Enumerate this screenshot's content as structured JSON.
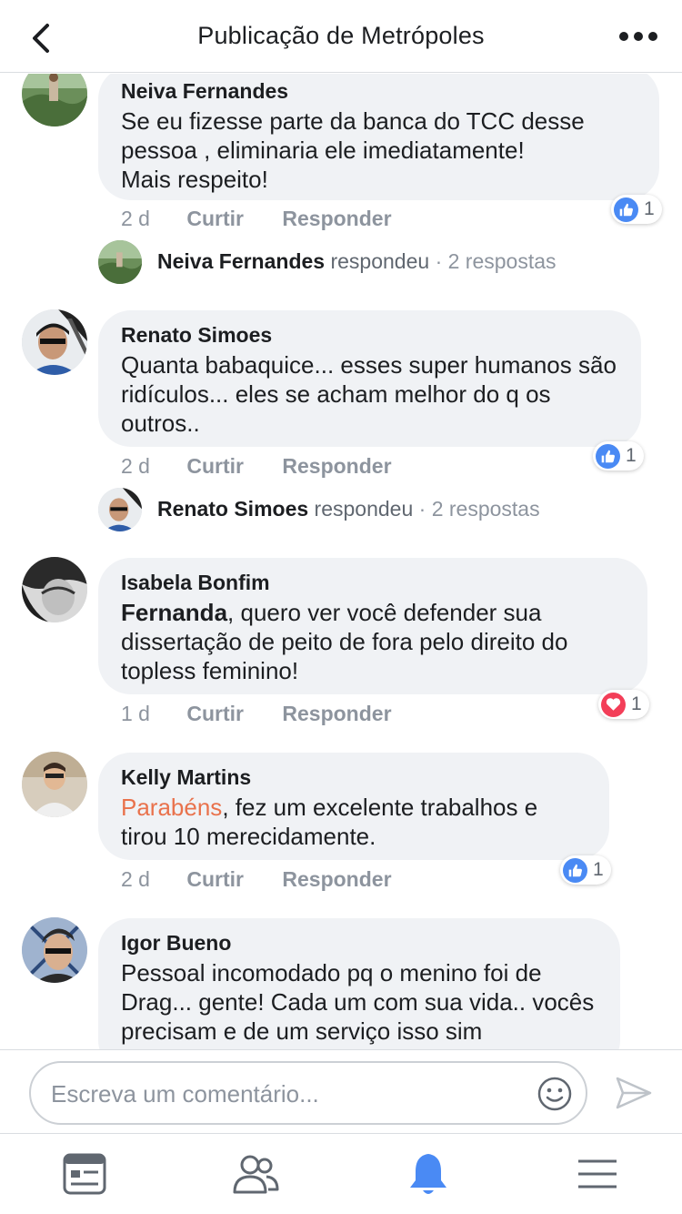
{
  "header": {
    "title": "Publicação de Metrópoles",
    "back_icon": "chevron-left-icon",
    "more_icon": "more-horizontal-icon"
  },
  "comments": [
    {
      "author": "Neiva Fernandes",
      "text": "Se eu fizesse parte da banca do TCC  desse pessoa ,  eliminaria  ele  imediatamente!\nMais respeito!",
      "time": "2 d",
      "like_label": "Curtir",
      "reply_label": "Responder",
      "reaction": {
        "type": "like",
        "count": "1"
      },
      "reply_summary": {
        "name": "Neiva Fernandes",
        "verb": "respondeu",
        "count": "· 2 respostas"
      }
    },
    {
      "author": "Renato Simoes",
      "text": "Quanta babaquice... esses super humanos são ridículos... eles se acham melhor do q os outros..",
      "time": "2 d",
      "like_label": "Curtir",
      "reply_label": "Responder",
      "reaction": {
        "type": "like",
        "count": "1"
      },
      "reply_summary": {
        "name": "Renato Simoes",
        "verb": "respondeu",
        "count": "· 2 respostas"
      }
    },
    {
      "author": "Isabela Bonfim",
      "mention": "Fernanda",
      "text": ", quero ver você defender sua dissertação de peito de fora pelo direito do topless feminino!",
      "time": "1 d",
      "like_label": "Curtir",
      "reply_label": "Responder",
      "reaction": {
        "type": "love",
        "count": "1"
      }
    },
    {
      "author": "Kelly Martins",
      "mention": "Parabéns",
      "text": ", fez um excelente trabalhos e tirou 10 merecidamente.",
      "time": "2 d",
      "like_label": "Curtir",
      "reply_label": "Responder",
      "reaction": {
        "type": "like",
        "count": "1"
      }
    },
    {
      "author": "Igor Bueno",
      "text": "Pessoal incomodado pq o menino foi de Drag... gente! Cada um com sua vida.. vocês precisam e de um serviço isso sim"
    }
  ],
  "composer": {
    "placeholder": "Escreva um comentário...",
    "emoji_icon": "smiley-icon",
    "send_icon": "send-icon"
  },
  "tabs": [
    {
      "name": "news-feed",
      "icon": "news-feed-icon"
    },
    {
      "name": "friends",
      "icon": "friends-icon"
    },
    {
      "name": "notifications",
      "icon": "bell-icon",
      "active": true
    },
    {
      "name": "menu",
      "icon": "hamburger-menu-icon"
    }
  ],
  "colors": {
    "accent": "#4a8af4",
    "love": "#f33e58",
    "mention_red": "#e9724c",
    "bubble": "#f0f2f5",
    "meta": "#8d949e"
  }
}
